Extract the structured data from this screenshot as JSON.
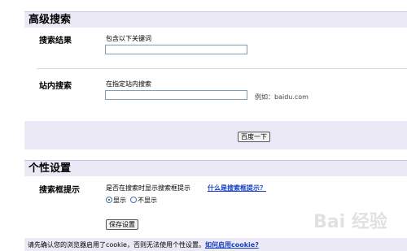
{
  "advanced": {
    "header": "高级搜索",
    "result_label": "搜索结果",
    "result_hint": "包含以下关键词",
    "result_value": "",
    "site_label": "站内搜索",
    "site_hint": "在指定站内搜索",
    "site_value": "",
    "site_example": "例如：baidu.com",
    "search_button": "百度一下"
  },
  "personal": {
    "header": "个性设置",
    "hint_label": "搜索框提示",
    "hint_question": "是否在搜索时显示搜索框提示",
    "hint_link": "什么是搜索框提示？",
    "show_label": "显示",
    "hide_label": "不显示",
    "selected": "show",
    "save_button": "保存设置"
  },
  "footer": {
    "notice": "请先确认您的浏览器启用了cookie，否则无法使用个性设置。",
    "link": "如何启用cookie?"
  },
  "watermark": "Bai 经验"
}
